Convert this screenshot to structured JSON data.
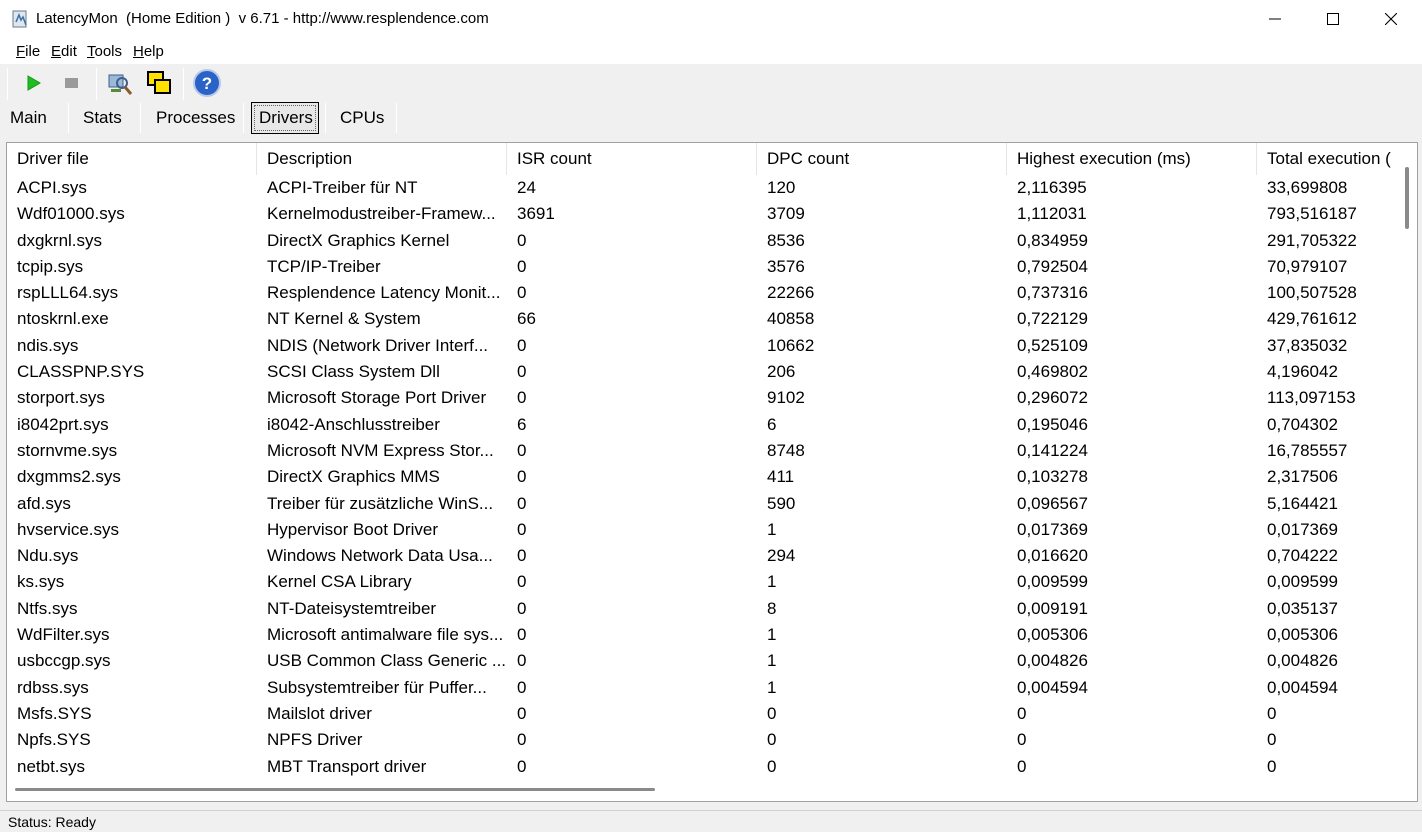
{
  "window": {
    "title": "LatencyMon  (Home Edition )  v 6.71 - http://www.resplendence.com"
  },
  "menu": [
    "File",
    "Edit",
    "Tools",
    "Help"
  ],
  "toolbar": {
    "icons": [
      "play-icon",
      "stop-icon",
      "analyze-icon",
      "windows-icon",
      "help-icon"
    ]
  },
  "tabs": [
    {
      "label": "Main"
    },
    {
      "label": "Stats"
    },
    {
      "label": "Processes"
    },
    {
      "label": "Drivers",
      "active": true
    },
    {
      "label": "CPUs"
    }
  ],
  "drivers_table": {
    "columns": [
      "Driver file",
      "Description",
      "ISR count",
      "DPC count",
      "Highest execution (ms)",
      "Total execution ("
    ],
    "rows": [
      [
        "ACPI.sys",
        "ACPI-Treiber für NT",
        "24",
        "120",
        "2,116395",
        "33,699808"
      ],
      [
        "Wdf01000.sys",
        "Kernelmodustreiber-Framew...",
        "3691",
        "3709",
        "1,112031",
        "793,516187"
      ],
      [
        "dxgkrnl.sys",
        "DirectX Graphics Kernel",
        "0",
        "8536",
        "0,834959",
        "291,705322"
      ],
      [
        "tcpip.sys",
        "TCP/IP-Treiber",
        "0",
        "3576",
        "0,792504",
        "70,979107"
      ],
      [
        "rspLLL64.sys",
        "Resplendence Latency Monit...",
        "0",
        "22266",
        "0,737316",
        "100,507528"
      ],
      [
        "ntoskrnl.exe",
        "NT Kernel & System",
        "66",
        "40858",
        "0,722129",
        "429,761612"
      ],
      [
        "ndis.sys",
        "NDIS (Network Driver Interf...",
        "0",
        "10662",
        "0,525109",
        "37,835032"
      ],
      [
        "CLASSPNP.SYS",
        "SCSI Class System Dll",
        "0",
        "206",
        "0,469802",
        "4,196042"
      ],
      [
        "storport.sys",
        "Microsoft Storage Port Driver",
        "0",
        "9102",
        "0,296072",
        "113,097153"
      ],
      [
        "i8042prt.sys",
        "i8042-Anschlusstreiber",
        "6",
        "6",
        "0,195046",
        "0,704302"
      ],
      [
        "stornvme.sys",
        "Microsoft NVM Express Stor...",
        "0",
        "8748",
        "0,141224",
        "16,785557"
      ],
      [
        "dxgmms2.sys",
        "DirectX Graphics MMS",
        "0",
        "411",
        "0,103278",
        "2,317506"
      ],
      [
        "afd.sys",
        "Treiber für zusätzliche WinS...",
        "0",
        "590",
        "0,096567",
        "5,164421"
      ],
      [
        "hvservice.sys",
        "Hypervisor Boot Driver",
        "0",
        "1",
        "0,017369",
        "0,017369"
      ],
      [
        "Ndu.sys",
        "Windows Network Data Usa...",
        "0",
        "294",
        "0,016620",
        "0,704222"
      ],
      [
        "ks.sys",
        "Kernel CSA Library",
        "0",
        "1",
        "0,009599",
        "0,009599"
      ],
      [
        "Ntfs.sys",
        "NT-Dateisystemtreiber",
        "0",
        "8",
        "0,009191",
        "0,035137"
      ],
      [
        "WdFilter.sys",
        "Microsoft antimalware file sys...",
        "0",
        "1",
        "0,005306",
        "0,005306"
      ],
      [
        "usbccgp.sys",
        "USB Common Class Generic ...",
        "0",
        "1",
        "0,004826",
        "0,004826"
      ],
      [
        "rdbss.sys",
        "Subsystemtreiber für Puffer...",
        "0",
        "1",
        "0,004594",
        "0,004594"
      ],
      [
        "Msfs.SYS",
        "Mailslot driver",
        "0",
        "0",
        "0",
        "0"
      ],
      [
        "Npfs.SYS",
        "NPFS Driver",
        "0",
        "0",
        "0",
        "0"
      ],
      [
        "netbt.sys",
        "MBT Transport driver",
        "0",
        "0",
        "0",
        "0"
      ]
    ]
  },
  "status": {
    "text": "Status: Ready"
  }
}
